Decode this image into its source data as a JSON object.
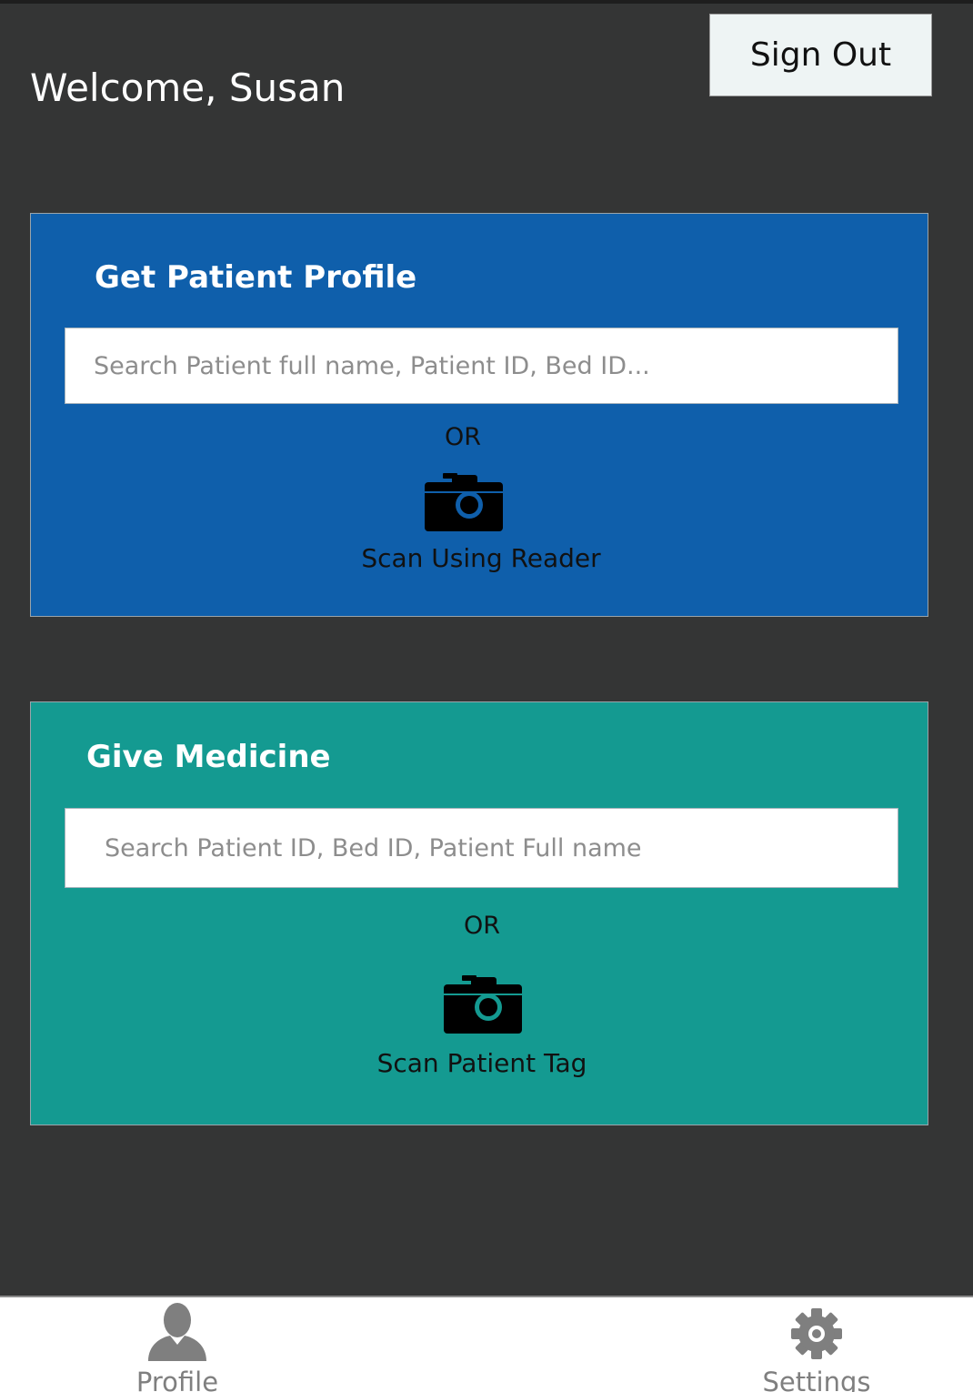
{
  "header": {
    "welcome_text": "Welcome, Susan",
    "sign_out_label": "Sign Out"
  },
  "patient_profile": {
    "title": "Get Patient Profile",
    "search_placeholder": "Search Patient full name, Patient ID, Bed ID...",
    "or_text": "OR",
    "scan_icon": "camera-icon",
    "scan_label": "Scan Using Reader",
    "color": "#0f5fab"
  },
  "give_medicine": {
    "title": "Give Medicine",
    "search_placeholder": "Search Patient ID, Bed ID, Patient Full name",
    "or_text": "OR",
    "scan_icon": "camera-icon",
    "scan_label": "Scan Patient Tag",
    "color": "#149a91"
  },
  "bottom_nav": {
    "items": [
      {
        "label": "Profile",
        "icon": "person-icon"
      },
      {
        "label": "Settings",
        "icon": "gear-icon"
      }
    ]
  },
  "colors": {
    "background": "#343535",
    "nav_icon": "#7f7f7f"
  }
}
